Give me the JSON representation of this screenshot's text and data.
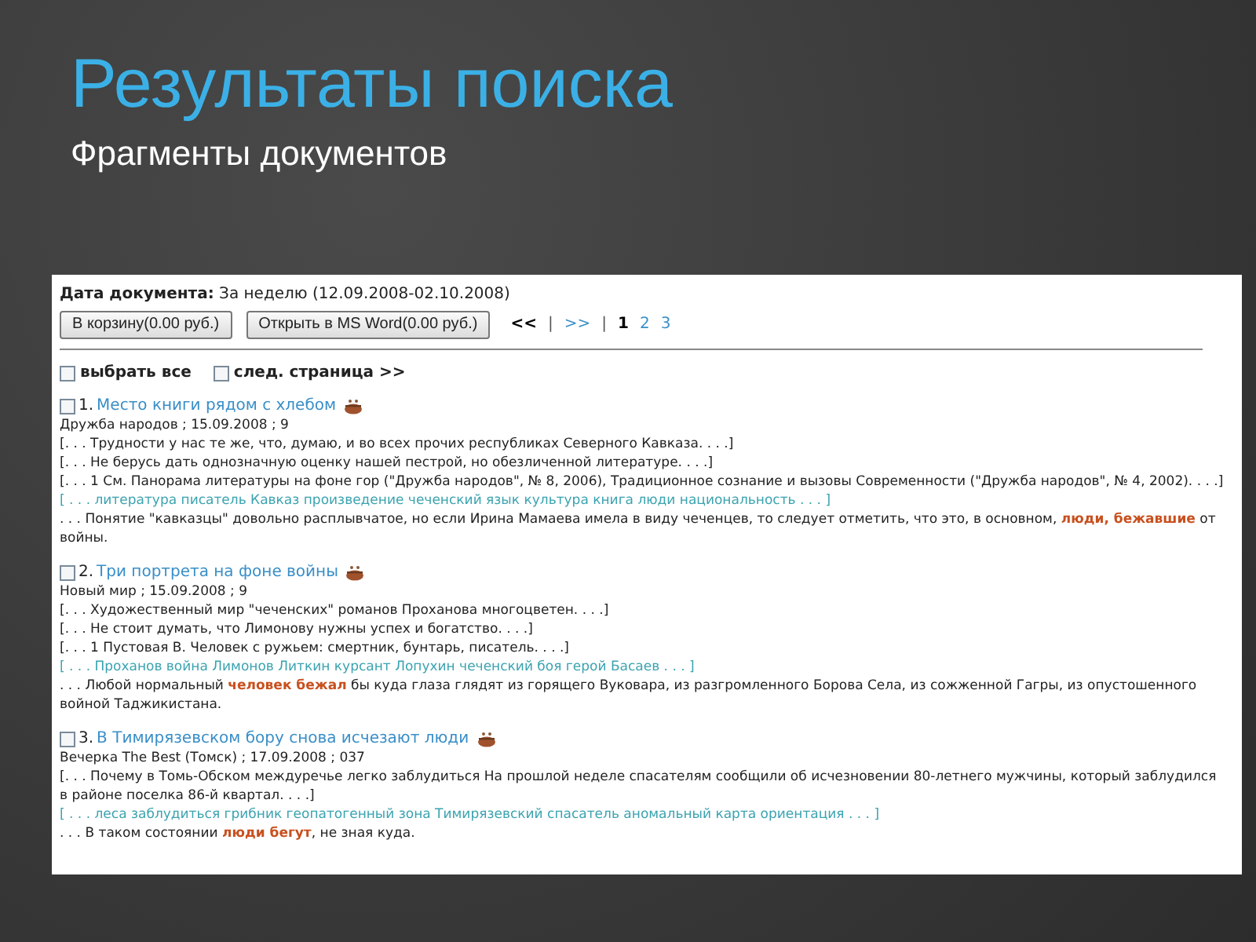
{
  "slide": {
    "title": "Результаты поиска",
    "subtitle": "Фрагменты документов"
  },
  "page": {
    "date_filter": {
      "label": "Дата документа:",
      "value": "За неделю (12.09.2008-02.10.2008)"
    },
    "buttons": [
      "В корзину(0.00 руб.)",
      "Открыть в MS Word(0.00 руб.)"
    ],
    "pagination": [
      {
        "kind": "nav",
        "label": "<<",
        "disabled": true
      },
      {
        "kind": "sep",
        "label": "|"
      },
      {
        "kind": "nav",
        "label": ">>",
        "disabled": false
      },
      {
        "kind": "sep",
        "label": "|"
      },
      {
        "kind": "page",
        "label": "1",
        "selected": true
      },
      {
        "kind": "page",
        "label": "2",
        "selected": false
      },
      {
        "kind": "page",
        "label": "3",
        "selected": false
      }
    ],
    "select_all": {
      "label": "выбрать все",
      "checked": false
    },
    "next_page": {
      "label": "след. страница >>",
      "checked": false
    },
    "results": [
      {
        "number": "1.",
        "title": "Место книги рядом с хлебом",
        "checked": false,
        "source": "Дружба народов ; 15.09.2008 ; 9",
        "fragments": [
          "[. . . Трудности у нас те же, что, думаю, и во всех прочих республиках Северного Кавказа. . . .]",
          "[. . . Не берусь дать однозначную оценку нашей пестрой, но обезличенной литературе. . . .]",
          "[. . . 1 См. Панорама литературы на фоне гор (\"Дружба народов\", № 8, 2006), Традиционное сознание и вызовы Современности (\"Дружба народов\", № 4, 2002). . . .]"
        ],
        "keywords": "[ . . . литература писатель Кавказ произведение чеченский язык культура книга люди национальность . . . ]",
        "excerpt": ". . . Понятие \"кавказцы\" довольно расплывчатое, но если Ирина Мамаева имела в виду чеченцев, то следует отметить, что это, в основном, **люди, бежавшие** от войны."
      },
      {
        "number": "2.",
        "title": "Три портрета на фоне войны",
        "checked": false,
        "source": "Новый мир ; 15.09.2008 ; 9",
        "fragments": [
          "[. . . Художественный мир \"чеченских\" романов Проханова многоцветен. . . .]",
          "[. . . Не стоит думать, что Лимонову нужны успех и богатство. . . .]",
          "[. . . 1 Пустовая В. Человек с ружьем: смертник, бунтарь, писатель. . . .]"
        ],
        "keywords": "[ . . . Проханов война Лимонов Литкин курсант Лопухин чеченский боя герой Басаев . . . ]",
        "excerpt": ". . . Любой нормальный **человек бежал** бы куда глаза глядят из горящего Вуковара, из разгромленного Борова Села, из сожженной Гагры, из опустошенного войной Таджикистана."
      },
      {
        "number": "3.",
        "title": "В Тимирязевском бору снова исчезают люди",
        "checked": false,
        "source": "Вечерка The Best (Томск) ; 17.09.2008 ; 037",
        "fragments": [
          "[. . . Почему в Томь-Обском междуречье легко заблудиться На прошлой неделе спасателям сообщили об исчезновении 80-летнего мужчины, который заблудился в районе поселка 86-й квартал. . . .]"
        ],
        "keywords": "[ . . . леса заблудиться грибник геопатогенный зона Тимирязевский спасатель аномальный карта ориентация . . . ]",
        "excerpt": ". . . В таком состоянии **люди бегут**, не зная куда."
      }
    ]
  }
}
